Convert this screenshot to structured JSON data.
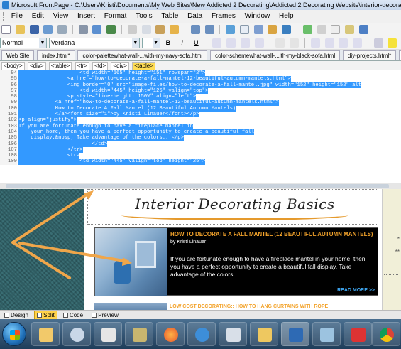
{
  "window": {
    "title": "Microsoft FrontPage - C:\\Users\\Kristi\\Documents\\My Web Sites\\New Addicted 2 Decorating\\Addicted 2 Decorating Website\\interior-decorating-and-diy-articles.h"
  },
  "menu": [
    "File",
    "Edit",
    "View",
    "Insert",
    "Format",
    "Tools",
    "Table",
    "Data",
    "Frames",
    "Window",
    "Help"
  ],
  "format_toolbar": {
    "style_value": "Normal",
    "font_value": "Verdana",
    "bold": "B",
    "italic": "I",
    "underline": "U"
  },
  "tabs": [
    {
      "label": "Web Site"
    },
    {
      "label": "index.html*"
    },
    {
      "label": "color-palettewhat-wall-...with-my-navy-sofa.html"
    },
    {
      "label": "color-schemewhat-wall-...ith-my-black-sofa.html"
    },
    {
      "label": "diy-projects.html*"
    },
    {
      "label": "decorate-b"
    }
  ],
  "breadcrumbs": [
    "<body>",
    "<div>",
    "<table>",
    "<tr>",
    "<td>",
    "<div>",
    "<table>"
  ],
  "code_lines": [
    {
      "n": "94",
      "text": "                    <td width=\"165\" height=\"151\" rowspan=\"2\">"
    },
    {
      "n": "95",
      "text": "                <a href=\"how-to-decorate-a-fall-mantel-12-beautiful-autumn-mantels.html\">"
    },
    {
      "n": "96",
      "text": "                <img border=\"0\" src=\"image-files/how-to-decorate-a-fall-mantel.jpg\" width=\"152\" height=\"152\" alt"
    },
    {
      "n": "97",
      "text": "                    <td width=\"445\" height=\"126\" valign=\"top\">"
    },
    {
      "n": "98",
      "text": "                <p style=\"line-height: 150%\" align=\"left\">"
    },
    {
      "n": "99",
      "text": "            <a href=\"how-to-decorate-a-fall-mantel-12-beautiful-autumn-mantels.html\">"
    },
    {
      "n": "100",
      "text": "            How to Decorate A Fall Mantel (12 Beautiful Autumn Mantels)"
    },
    {
      "n": "101",
      "text": "            </a><font size=\"1\">by Kristi Linauer</font></p>"
    },
    {
      "n": "102",
      "text": "<p align=\"justify\">"
    },
    {
      "n": "103",
      "text": "If you are fortunate enough to have a fireplace mantel in"
    },
    {
      "n": "104",
      "text": "    your home, then you have a perfect opportunity to create a beautiful fall"
    },
    {
      "n": "105",
      "text": "    display.&nbsp; Take advantage of the colors...</p>"
    },
    {
      "n": "106",
      "text": "                        </td>"
    },
    {
      "n": "107",
      "text": "                </tr>"
    },
    {
      "n": "108",
      "text": "                <tr>"
    },
    {
      "n": "109",
      "text": "                    <td width=\"445\" valign=\"top\" height=\"25\">"
    }
  ],
  "design": {
    "heading": "Interior Decorating Basics",
    "article1": {
      "title": "HOW TO DECORATE A FALL MANTEL (12 BEAUTIFUL AUTUMN MANTELS)",
      "byline": "by Kristi Linauer",
      "body": "If you are fortunate enough to have a fireplace mantel in your home, then you have a perfect opportunity to create a beautiful fall display.  Take advantage of the colors...",
      "readmore": "READ MORE >>"
    },
    "article2": {
      "title": "LOW COST DECORATING:: HOW TO HANG CURTAINS WITH ROPE"
    }
  },
  "view_buttons": [
    {
      "label": "Design"
    },
    {
      "label": "Split"
    },
    {
      "label": "Code"
    },
    {
      "label": "Preview"
    }
  ],
  "colors": {
    "accent_orange": "#f3a32b",
    "selection_blue": "#3399ff",
    "card_bg": "#000000",
    "readmore_blue": "#3fa9f5"
  },
  "taskbar_icons": [
    "start",
    "explorer",
    "media",
    "paint",
    "firefox",
    "ie",
    "frontpage-web",
    "frontpage-doc",
    "word",
    "window-a",
    "acrobat",
    "window-b",
    "chrome"
  ]
}
